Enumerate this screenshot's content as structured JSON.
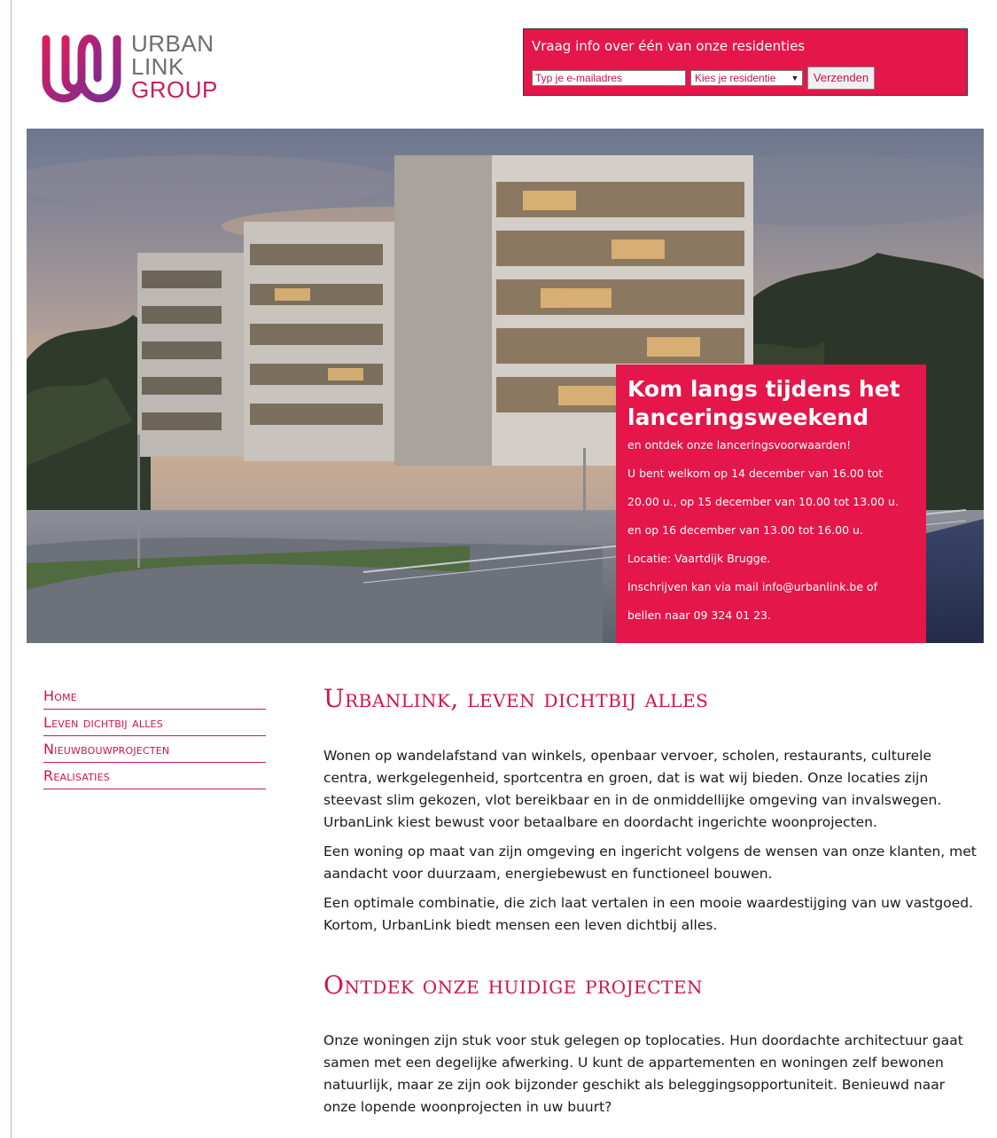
{
  "logo": {
    "line1": "URBAN",
    "line2": "LINK",
    "line3": "GROUP"
  },
  "info_form": {
    "title": "Vraag info over één van onze residenties",
    "email_placeholder": "Typ je e-mailadres",
    "residence_selected": "Kies je residentie",
    "submit_label": "Verzenden"
  },
  "promo": {
    "title": "Kom langs tijdens het lanceringsweekend",
    "lines": [
      "en ontdek onze lanceringsvoorwaarden!",
      "U bent welkom op 14 december van 16.00 tot",
      "20.00 u., op 15 december van 10.00 tot 13.00 u.",
      "en op 16 december van 13.00 tot 16.00 u.",
      "Locatie: Vaartdijk Brugge.",
      "Inschrijven kan via mail info@urbanlink.be of",
      "bellen naar 09 324 01 23."
    ]
  },
  "nav": {
    "items": [
      {
        "label": "Home"
      },
      {
        "label": "Leven dichtbij alles"
      },
      {
        "label": "Nieuwbouwprojecten"
      },
      {
        "label": "Realisaties"
      }
    ]
  },
  "main": {
    "heading1": "Urbanlink, leven dichtbij alles",
    "paragraph1": "Wonen op wandelafstand van winkels, openbaar vervoer, scholen, restaurants, culturele centra, werkgelegenheid, sportcentra en groen, dat is wat wij bieden. Onze locaties zijn steevast slim gekozen, vlot bereikbaar en in de onmiddellijke omgeving van invalswegen. UrbanLink kiest bewust voor betaalbare en doordacht ingerichte woonprojecten.",
    "paragraph2": "Een woning op maat van zijn omgeving en ingericht volgens de wensen van onze klanten, met aandacht voor duurzaam, energiebewust en functioneel bouwen.",
    "paragraph3": "Een optimale combinatie, die zich laat vertalen in een mooie waardestijging van uw vastgoed. Kortom, UrbanLink biedt mensen een leven dichtbij alles.",
    "heading2": "Ontdek onze huidige projecten",
    "paragraph4": "Onze woningen zijn stuk voor stuk gelegen op toplocaties. Hun doordachte architectuur gaat samen met een degelijke afwerking. U kunt de appartementen en woningen zelf bewonen natuurlijk, maar ze zijn ook bijzonder geschikt als beleggingsopportuniteit. Benieuwd naar onze lopende woonprojecten in uw buurt?"
  },
  "colors": {
    "brand_pink": "#e5164a",
    "heading_pink": "#d4124d",
    "logo_grey": "#6e6e6e",
    "logo_purple": "#8a2a8f"
  },
  "icons": {
    "select_chevron": "chevron-down-icon"
  }
}
